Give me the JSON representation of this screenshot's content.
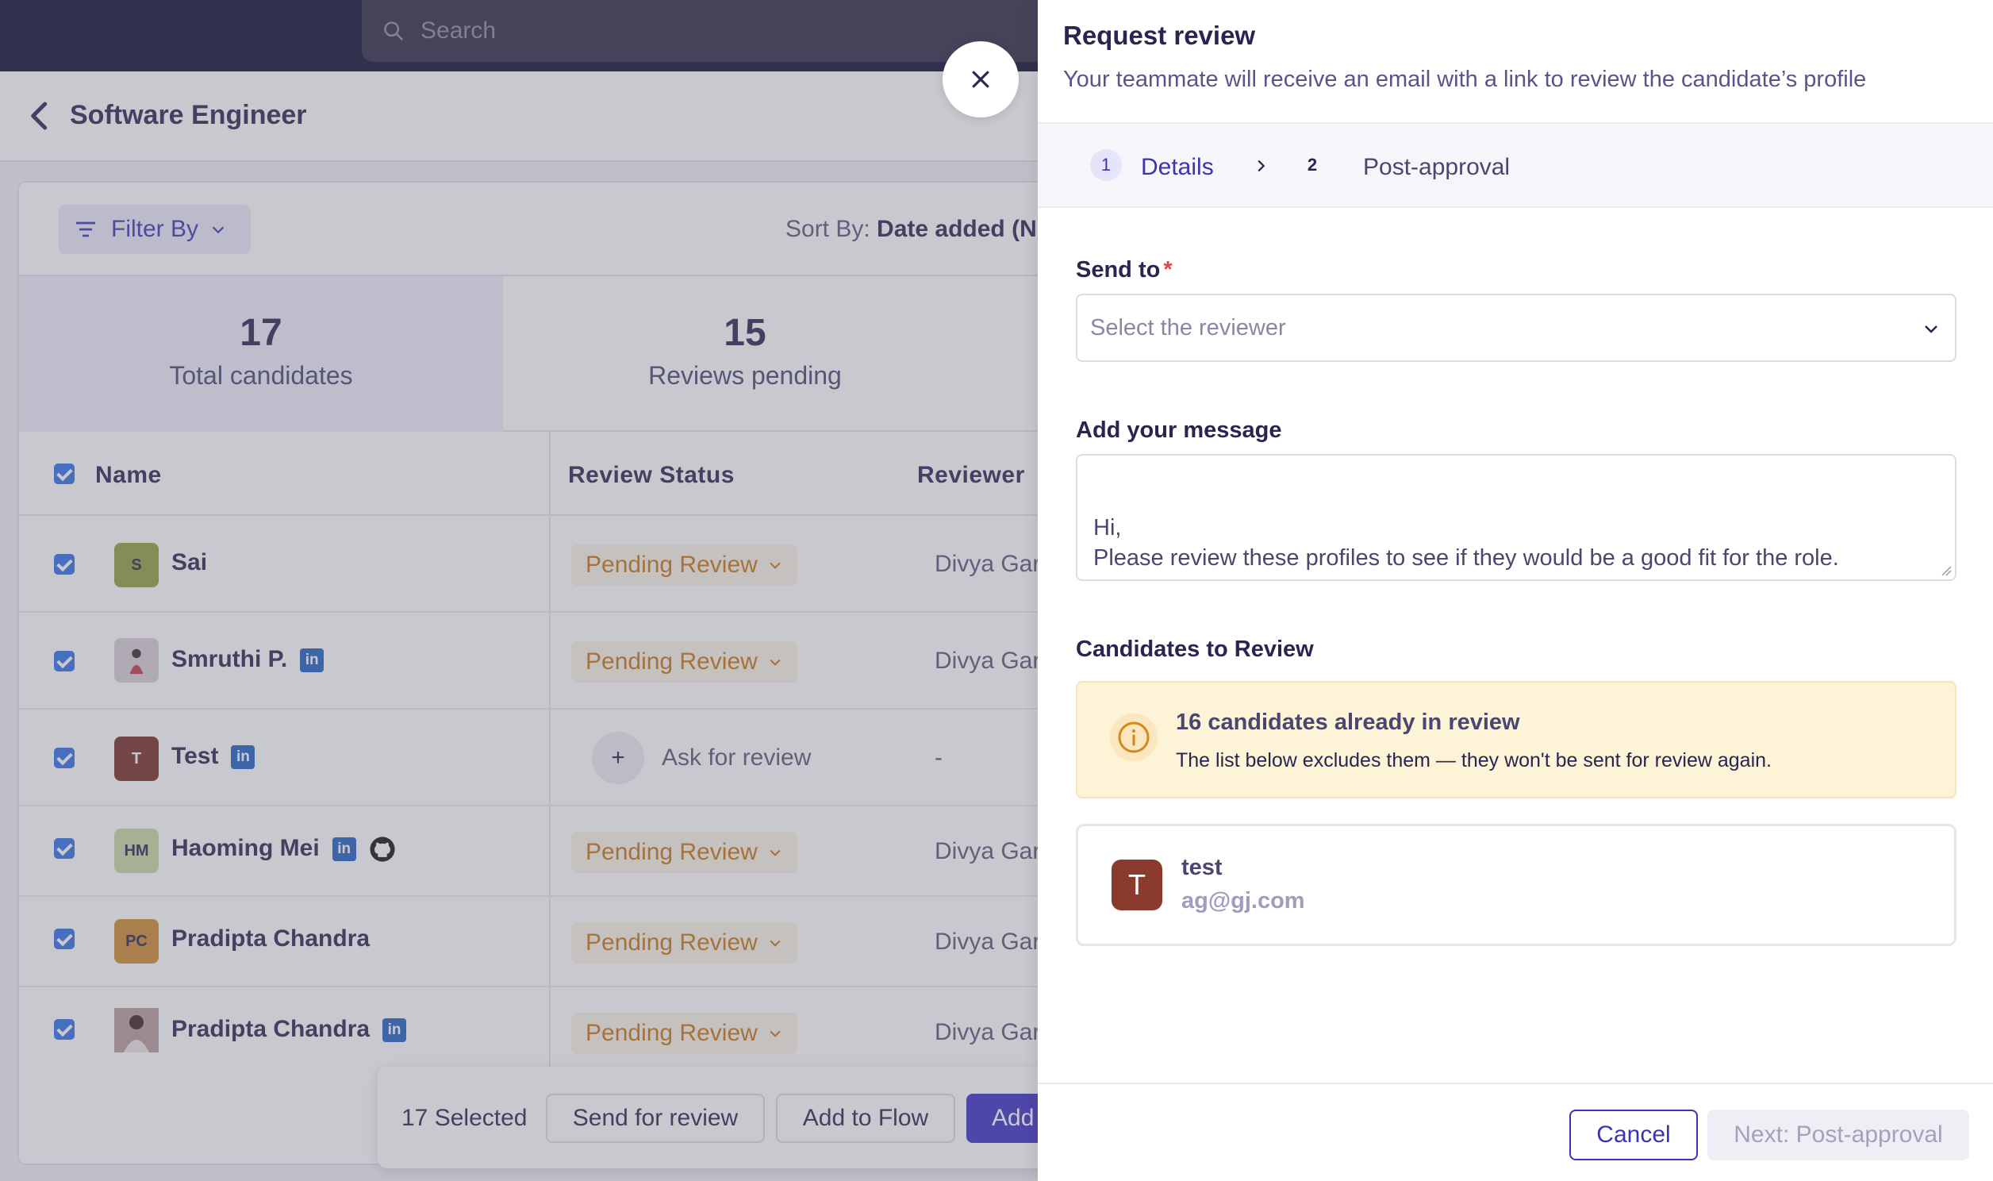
{
  "app": {
    "search_placeholder": "Search",
    "page_title": "Software Engineer",
    "filter_label": "Filter By",
    "sort_label": "Sort By:",
    "sort_value": "Date added (Ne"
  },
  "stats": [
    {
      "num": "17",
      "label": "Total candidates"
    },
    {
      "num": "15",
      "label": "Reviews pending"
    }
  ],
  "table": {
    "headers": {
      "name": "Name",
      "status": "Review Status",
      "reviewer": "Reviewer"
    },
    "rows": [
      {
        "initials": "S",
        "name": "Sai",
        "status": "Pending Review",
        "reviewer": "Divya Gar"
      },
      {
        "initials": "",
        "name": "Smruthi P.",
        "li": "in",
        "status": "Pending Review",
        "reviewer": "Divya Gar"
      },
      {
        "initials": "T",
        "name": "Test",
        "li": "in",
        "ask": "Ask for review",
        "reviewer": "-"
      },
      {
        "initials": "HM",
        "name": "Haoming Mei",
        "li": "in",
        "status": "Pending Review",
        "reviewer": "Divya Gar"
      },
      {
        "initials": "PC",
        "name": "Pradipta Chandra",
        "status": "Pending Review",
        "reviewer": "Divya Gar"
      },
      {
        "initials": "",
        "name": "Pradipta Chandra",
        "li": "in",
        "status": "Pending Review",
        "reviewer": "Divya Gar"
      }
    ]
  },
  "actionbar": {
    "selected": "17 Selected",
    "send": "Send for review",
    "flow": "Add to Flow",
    "add": "Add"
  },
  "drawer": {
    "title": "Request review",
    "subtitle": "Your teammate will receive an email with a link to review the candidate’s profile",
    "steps": [
      {
        "num": "1",
        "label": "Details"
      },
      {
        "num": "2",
        "label": "Post-approval"
      }
    ],
    "send_to_label": "Send to",
    "required_mark": "*",
    "reviewer_placeholder": "Select the reviewer",
    "message_label": "Add your message",
    "message_text": "Hi,\nPlease review these profiles to see if they would be a good fit for the role.",
    "candidates_label": "Candidates to Review",
    "notice_title": "16 candidates already in review",
    "notice_text": "The list below excludes them — they won't be sent for review again.",
    "candidate": {
      "initial": "T",
      "name": "test",
      "email": "ag@gj.com"
    },
    "cancel": "Cancel",
    "next": "Next: Post-approval"
  },
  "colors": {
    "accent": "#3b34b0",
    "pending": "#c97512",
    "notice_bg": "#fdf3d6",
    "topbar": "#0e0c2e"
  }
}
